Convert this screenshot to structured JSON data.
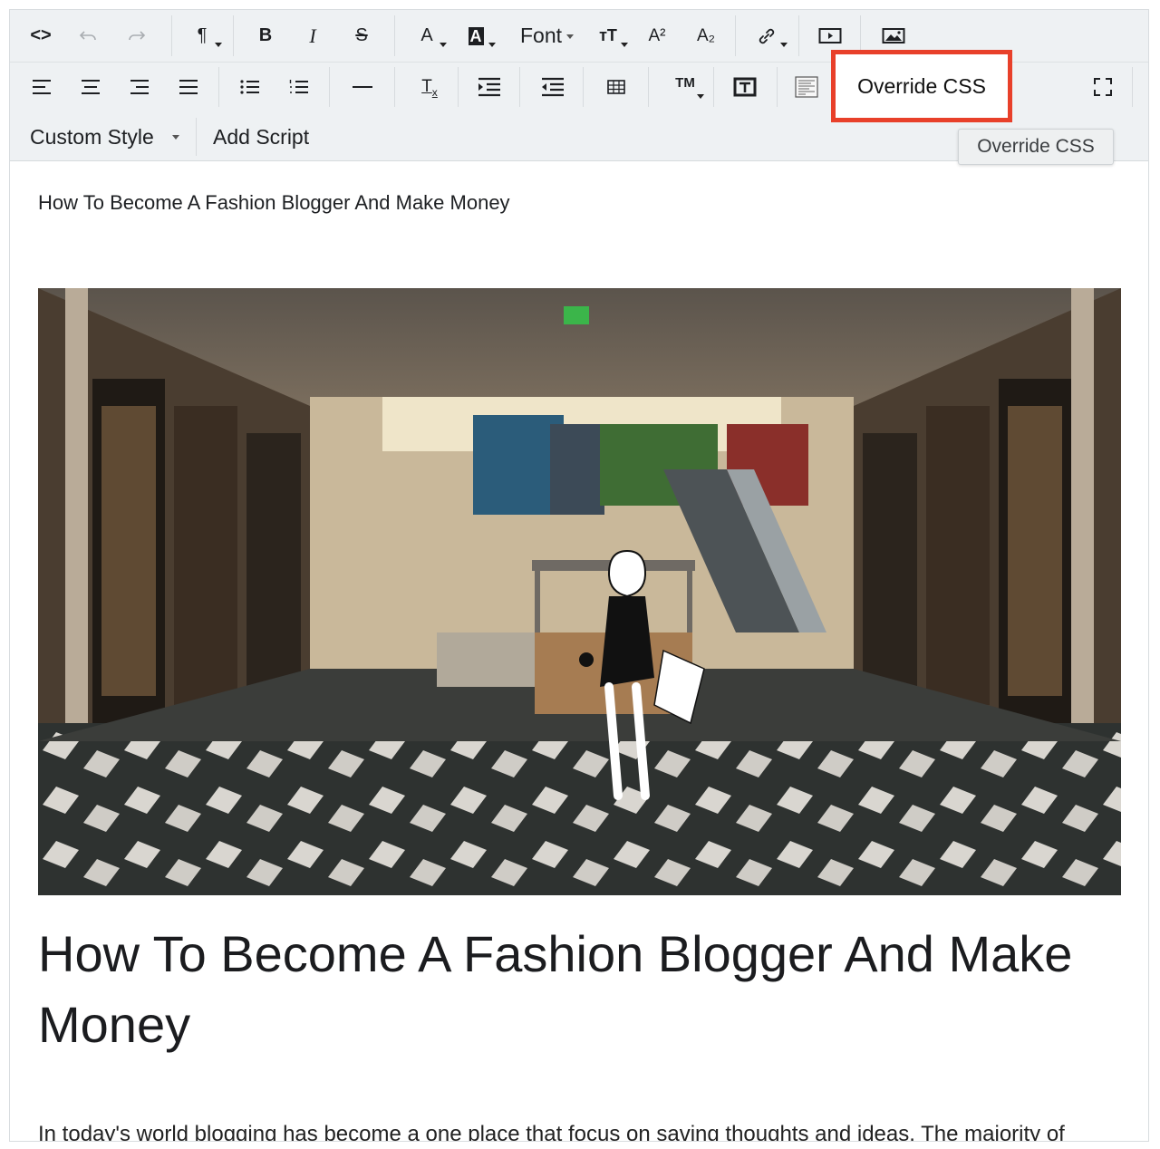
{
  "toolbar": {
    "font_label": "Font",
    "override_css_label": "Override CSS",
    "override_css_tooltip": "Override CSS",
    "custom_style_label": "Custom Style",
    "add_script_label": "Add Script",
    "trademark_label": "TM",
    "code_view_label": "<>",
    "paragraph_label": "¶",
    "bold_label": "B",
    "italic_label": "I",
    "strike_label": "S",
    "font_color_label": "A",
    "highlight_label": "A",
    "superscript_label": "A²",
    "subscript_label": "A₂",
    "clear_format_label": "T"
  },
  "content": {
    "small_title": "How To Become A Fashion Blogger And Make Money",
    "big_title": "How To Become A Fashion Blogger And Make Money",
    "cut_text": "In today's world blogging has become a one place that focus on saving thoughts and ideas. The majority of"
  },
  "colors": {
    "toolbar_bg": "#eef1f3",
    "highlight_border": "#e8402a"
  }
}
